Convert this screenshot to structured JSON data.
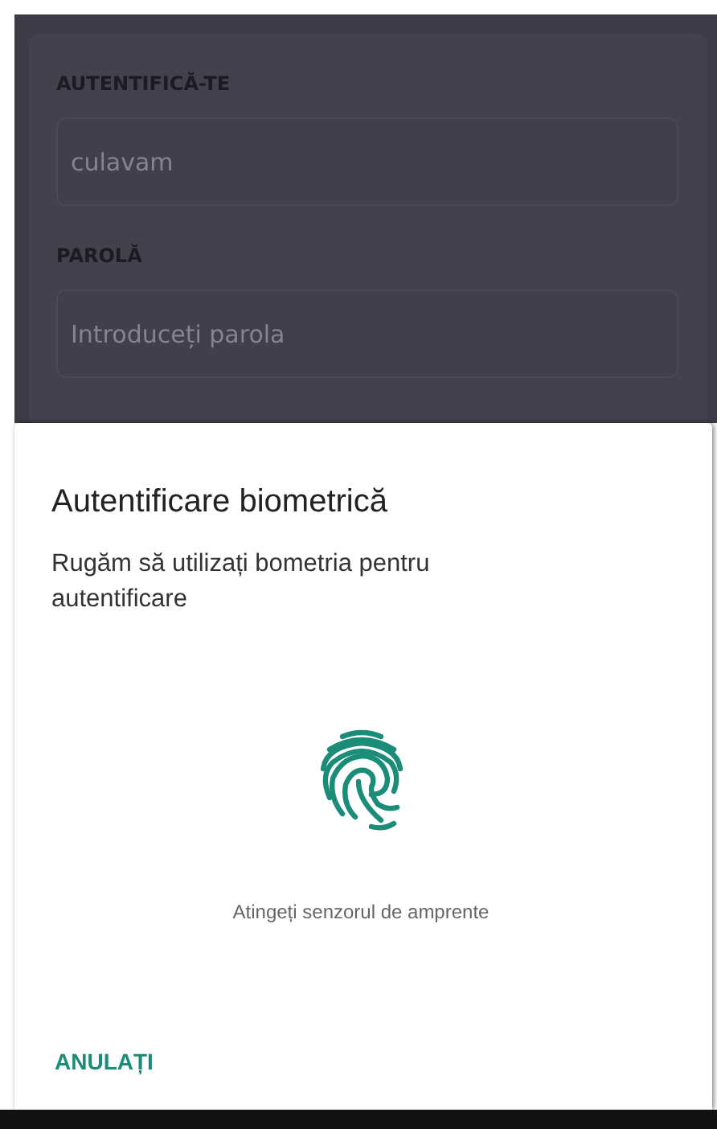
{
  "login_form": {
    "fields": [
      {
        "label": "AUTENTIFICĂ-TE",
        "value": "culavam"
      },
      {
        "label": "PAROLĂ",
        "placeholder": "Introduceți parola"
      }
    ]
  },
  "biometric_dialog": {
    "title": "Autentificare biometrică",
    "message": "Rugăm să utilizați bometria pentru autentificare",
    "hint": "Atingeți senzorul de amprente",
    "cancel_button": "ANULAȚI"
  }
}
